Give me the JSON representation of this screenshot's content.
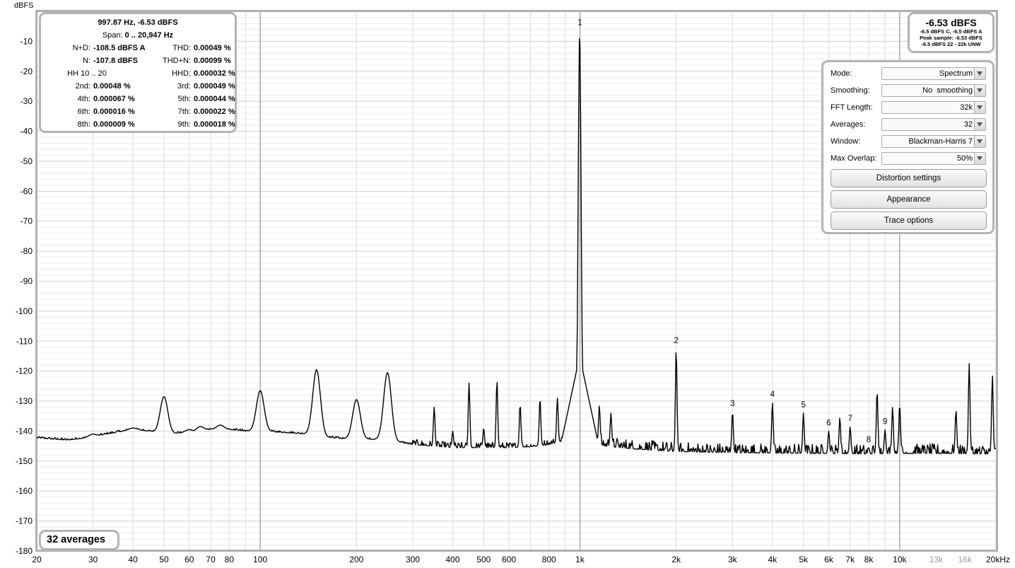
{
  "chart_data": {
    "type": "line",
    "ylabel": "dBFS",
    "ylim": [
      -180,
      0
    ],
    "y_ticks": [
      "-10",
      "-20",
      "-30",
      "-40",
      "-50",
      "-60",
      "-70",
      "-80",
      "-90",
      "-100",
      "-110",
      "-120",
      "-130",
      "-140",
      "-150",
      "-160",
      "-170",
      "-180"
    ],
    "x_scale": "log",
    "xlim": [
      20,
      20000
    ],
    "x_ticks": [
      {
        "value": 20,
        "label": "20",
        "muted": false
      },
      {
        "value": 30,
        "label": "30",
        "muted": false
      },
      {
        "value": 40,
        "label": "40",
        "muted": false
      },
      {
        "value": 50,
        "label": "50",
        "muted": false
      },
      {
        "value": 60,
        "label": "60",
        "muted": false
      },
      {
        "value": 70,
        "label": "70",
        "muted": false
      },
      {
        "value": 80,
        "label": "80",
        "muted": false
      },
      {
        "value": 100,
        "label": "100",
        "muted": false
      },
      {
        "value": 200,
        "label": "200",
        "muted": false
      },
      {
        "value": 300,
        "label": "300",
        "muted": false
      },
      {
        "value": 400,
        "label": "400",
        "muted": false
      },
      {
        "value": 500,
        "label": "500",
        "muted": false
      },
      {
        "value": 600,
        "label": "600",
        "muted": false
      },
      {
        "value": 800,
        "label": "800",
        "muted": false
      },
      {
        "value": 1000,
        "label": "1k",
        "muted": false
      },
      {
        "value": 2000,
        "label": "2k",
        "muted": false
      },
      {
        "value": 3000,
        "label": "3k",
        "muted": false
      },
      {
        "value": 4000,
        "label": "4k",
        "muted": false
      },
      {
        "value": 5000,
        "label": "5k",
        "muted": false
      },
      {
        "value": 6000,
        "label": "6k",
        "muted": false
      },
      {
        "value": 7000,
        "label": "7k",
        "muted": false
      },
      {
        "value": 8000,
        "label": "8k",
        "muted": false
      },
      {
        "value": 10000,
        "label": "10k",
        "muted": false
      },
      {
        "value": 13000,
        "label": "13k",
        "muted": true
      },
      {
        "value": 16000,
        "label": "16k",
        "muted": true
      },
      {
        "value": 20000,
        "label": "20kHz",
        "muted": false
      }
    ],
    "noise_floor": [
      [
        20,
        -142.3
      ],
      [
        25,
        -143
      ],
      [
        30,
        -142
      ],
      [
        33,
        -141
      ],
      [
        40,
        -139.5
      ],
      [
        45,
        -140
      ],
      [
        50,
        -141
      ],
      [
        60,
        -140.5
      ],
      [
        70,
        -139.5
      ],
      [
        80,
        -139.5
      ],
      [
        90,
        -140
      ],
      [
        100,
        -140
      ],
      [
        120,
        -140.5
      ],
      [
        140,
        -141
      ],
      [
        160,
        -142
      ],
      [
        180,
        -142.5
      ],
      [
        200,
        -142.5
      ],
      [
        250,
        -143
      ],
      [
        300,
        -144.5
      ],
      [
        400,
        -145.5
      ],
      [
        500,
        -145.5
      ],
      [
        600,
        -145.5
      ],
      [
        700,
        -145.2
      ],
      [
        800,
        -144.5
      ],
      [
        900,
        -143
      ],
      [
        1000,
        -140
      ],
      [
        1100,
        -143.5
      ],
      [
        1200,
        -145
      ],
      [
        1500,
        -146
      ],
      [
        2000,
        -146.8
      ],
      [
        3000,
        -147.2
      ],
      [
        5000,
        -147.4
      ],
      [
        8000,
        -147.6
      ],
      [
        12000,
        -147.4
      ],
      [
        20000,
        -147.6
      ]
    ],
    "peaks": [
      {
        "f": 30,
        "db": -141
      },
      {
        "f": 40,
        "db": -139
      },
      {
        "f": 50,
        "db": -128.5
      },
      {
        "f": 60,
        "db": -139.5
      },
      {
        "f": 65,
        "db": -138.5
      },
      {
        "f": 75,
        "db": -138
      },
      {
        "f": 100,
        "db": -126.5
      },
      {
        "f": 150,
        "db": -119.5
      },
      {
        "f": 200,
        "db": -129.5
      },
      {
        "f": 250,
        "db": -120.5
      },
      {
        "f": 350,
        "db": -132
      },
      {
        "f": 400,
        "db": -140
      },
      {
        "f": 450,
        "db": -124
      },
      {
        "f": 500,
        "db": -139
      },
      {
        "f": 550,
        "db": -123
      },
      {
        "f": 650,
        "db": -131
      },
      {
        "f": 750,
        "db": -129
      },
      {
        "f": 850,
        "db": -129
      },
      {
        "f": 997.87,
        "db": -6.53
      },
      {
        "f": 1150,
        "db": -131.5
      },
      {
        "f": 1250,
        "db": -134
      },
      {
        "f": 2000,
        "db": -112.5
      },
      {
        "f": 3000,
        "db": -133.5
      },
      {
        "f": 4000,
        "db": -130.5
      },
      {
        "f": 5000,
        "db": -134
      },
      {
        "f": 6000,
        "db": -140
      },
      {
        "f": 6500,
        "db": -135.5
      },
      {
        "f": 7000,
        "db": -138.5
      },
      {
        "f": 8000,
        "db": -145.5
      },
      {
        "f": 8500,
        "db": -126.5
      },
      {
        "f": 9000,
        "db": -139.5
      },
      {
        "f": 9500,
        "db": -132
      },
      {
        "f": 10000,
        "db": -131
      },
      {
        "f": 15000,
        "db": -133
      },
      {
        "f": 16500,
        "db": -117.5
      },
      {
        "f": 19500,
        "db": -121.5
      }
    ],
    "harmonic_markers": [
      {
        "label": "1",
        "f": 1000,
        "db": -6.53
      },
      {
        "label": "2",
        "f": 2000,
        "db": -112.5
      },
      {
        "label": "3",
        "f": 3000,
        "db": -133.5
      },
      {
        "label": "4",
        "f": 4000,
        "db": -130.5
      },
      {
        "label": "5",
        "f": 5000,
        "db": -134
      },
      {
        "label": "6",
        "f": 6000,
        "db": -140
      },
      {
        "label": "7",
        "f": 7000,
        "db": -138.5
      },
      {
        "label": "8",
        "f": 8000,
        "db": -145.5
      },
      {
        "label": "9",
        "f": 9000,
        "db": -139.5
      }
    ]
  },
  "readout": {
    "title": "997.87 Hz, -6.53 dBFS",
    "span_label": "Span:",
    "span_value": "0 .. 20,947 Hz",
    "rows": [
      {
        "l1": "N+D:",
        "v1": "-108.5 dBFS A",
        "l2": "THD:",
        "v2": "0.00049 %"
      },
      {
        "l1": "N:",
        "v1": "-107.8 dBFS",
        "l2": "THD+N:",
        "v2": "0.00099 %"
      },
      {
        "l1": "HH 10 .. 20",
        "v1": "",
        "l2": "HHD:",
        "v2": "0.000032 %"
      },
      {
        "l1": "2nd:",
        "v1": "0.00048 %",
        "l2": "3rd:",
        "v2": "0.000049 %"
      },
      {
        "l1": "4th:",
        "v1": "0.000067 %",
        "l2": "5th:",
        "v2": "0.000044 %"
      },
      {
        "l1": "6th:",
        "v1": "0.000016 %",
        "l2": "7th:",
        "v2": "0.000022 %"
      },
      {
        "l1": "8th:",
        "v1": "0.000009 %",
        "l2": "9th:",
        "v2": "0.000018 %"
      }
    ]
  },
  "level": {
    "main": "-6.53 dBFS",
    "line1": "-6.5 dBFS C, -6.5 dBFS A",
    "line2": "Peak sample: -6.53 dBFS",
    "line3": "-6.5 dBFS 22 - 22k UNW"
  },
  "controls": {
    "mode": {
      "label": "Mode:",
      "value": "Spectrum"
    },
    "smoothing": {
      "label": "Smoothing:",
      "value": "No  smoothing"
    },
    "fft": {
      "label": "FFT Length:",
      "value": "32k"
    },
    "averages": {
      "label": "Averages:",
      "value": "32"
    },
    "window": {
      "label": "Window:",
      "value": "Blackman-Harris 7"
    },
    "overlap": {
      "label": "Max Overlap:",
      "value": "50%"
    },
    "distortion_button": "Distortion settings",
    "appearance_button": "Appearance",
    "trace_button": "Trace options"
  },
  "averages_badge": "32 averages",
  "colors": {
    "trace": "#000000",
    "grid": "#e3e3e3",
    "grid_major": "#c4c4c4",
    "frame": "#b0b0b0",
    "muted_label": "#9a9a9a"
  }
}
